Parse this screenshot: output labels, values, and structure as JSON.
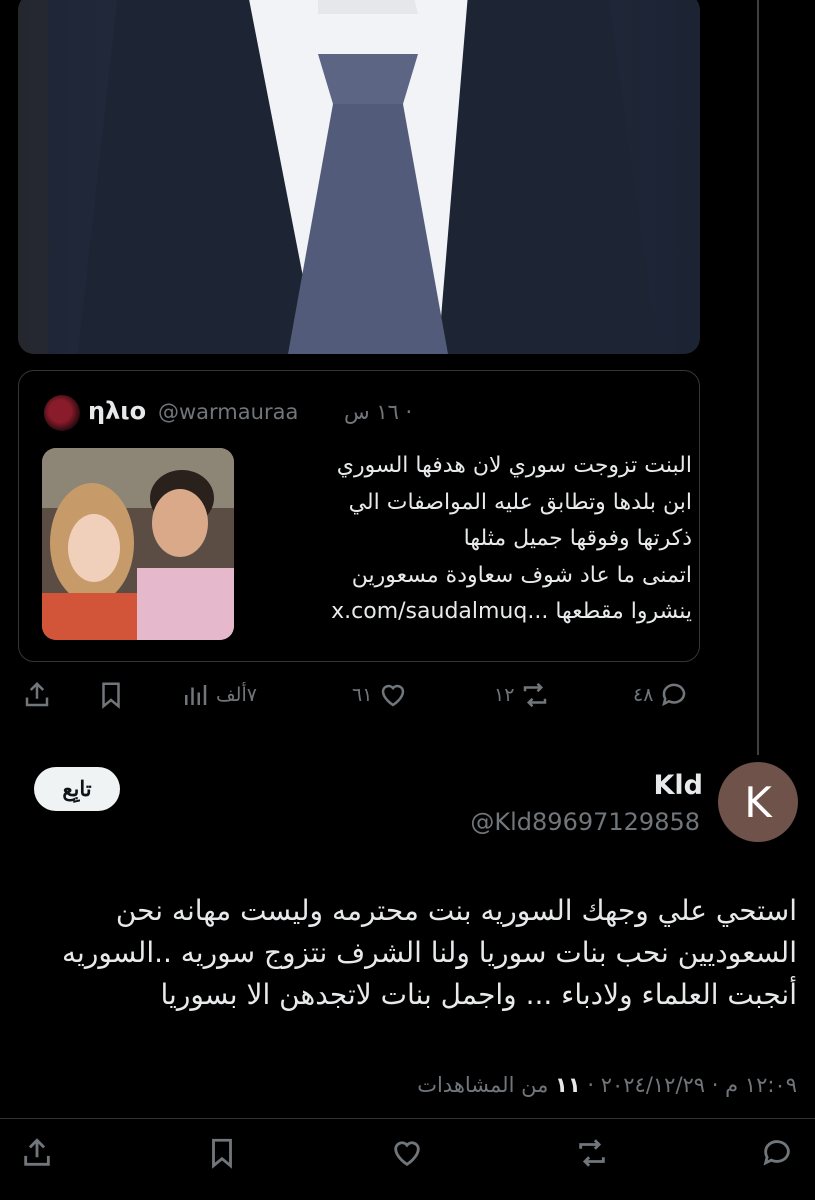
{
  "quoted_tweet": {
    "name": "ηλιο",
    "handle": "@warmauraa",
    "time": "· ١٦ س",
    "text_lines": [
      "البنت تزوجت سوري لان هدفها السوري",
      "ابن بلدها وتطابق عليه المواصفات الي",
      "ذكرتها وفوقها جميل مثلها",
      "اتمنى ما عاد شوف سعاودة مسعورين",
      "ينشروا مقطعها ...x.com/saudalmuq"
    ]
  },
  "actions_top": {
    "replies": "٤٨",
    "retweets": "١٢",
    "likes": "٦١",
    "views": "٧ألف"
  },
  "reply": {
    "avatar_letter": "K",
    "name": "Kld",
    "handle": "@Kld89697129858",
    "follow_label": "تابِع",
    "text_lines": [
      "استحي علي وجهك السوريه بنت محترمه وليست مهانه  نحن",
      "السعوديين نحب  بنات سوريا  ولنا الشرف  نتزوج سوريه ..السوريه",
      "أنجبت العلماء ولادباء   ... واجمل بنات لاتجدهن الا بسوريا"
    ],
    "timestamp": "١٢:٠٩ م · ٢٠٢٤/١٢/٢٩ ·",
    "views_count": "١١",
    "views_label": "من المشاهدات"
  }
}
